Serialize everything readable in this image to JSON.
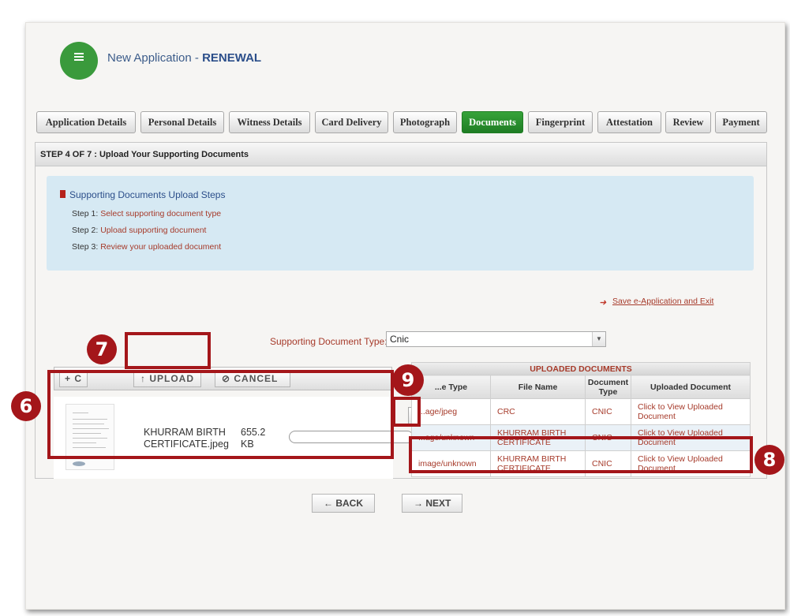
{
  "header": {
    "title_prefix": "New Application - ",
    "title_emphasis": "RENEWAL"
  },
  "tabs": [
    {
      "label": "Application Details",
      "active": false
    },
    {
      "label": "Personal Details",
      "active": false
    },
    {
      "label": "Witness Details",
      "active": false
    },
    {
      "label": "Card Delivery",
      "active": false
    },
    {
      "label": "Photograph",
      "active": false
    },
    {
      "label": "Documents",
      "active": true
    },
    {
      "label": "Fingerprint",
      "active": false
    },
    {
      "label": "Attestation",
      "active": false
    },
    {
      "label": "Review",
      "active": false
    },
    {
      "label": "Payment",
      "active": false
    }
  ],
  "step_bar": "STEP 4 OF 7 : Upload Your Supporting Documents",
  "steps_box": {
    "heading": "Supporting Documents Upload Steps",
    "steps": [
      {
        "prefix": "Step 1:",
        "text": "Select supporting document type"
      },
      {
        "prefix": "Step 2:",
        "text": "Upload supporting document"
      },
      {
        "prefix": "Step 3:",
        "text": "Review your uploaded document"
      }
    ]
  },
  "save_exit": "Save e-Application and Exit",
  "doc_type": {
    "label": "Supporting Document Type:",
    "required_mark": "*",
    "selected": "Cnic"
  },
  "upload_toolbar": {
    "choose_label": "+ C",
    "upload_label": "↑ UPLOAD",
    "cancel_label": "⊘ CANCEL"
  },
  "file": {
    "name": "KHURRAM BIRTH CERTIFICATE.jpeg",
    "size": "655.2 KB",
    "remove_label": "×"
  },
  "uploaded": {
    "caption": "UPLOADED DOCUMENTS",
    "columns": [
      "...e Type",
      "File Name",
      "Document Type",
      "Uploaded Document"
    ],
    "rows": [
      {
        "file_type": "...age/jpeg",
        "file_name": "CRC",
        "doc_type": "CNIC",
        "link": "Click to View Uploaded Document"
      },
      {
        "file_type": "...age/unknown",
        "file_name": "KHURRAM BIRTH CERTIFICATE",
        "doc_type": "CNIC",
        "link": "Click to View Uploaded Document"
      },
      {
        "file_type": "image/unknown",
        "file_name": "KHURRAM BIRTH CERTIFICATE",
        "doc_type": "CNIC",
        "link": "Click to View Uploaded Document"
      }
    ]
  },
  "nav": {
    "back_label": "← BACK",
    "next_label": "→ NEXT"
  },
  "callouts": [
    "6",
    "7",
    "8",
    "9"
  ],
  "colors": {
    "accent_green": "#2e9a33",
    "callout_red": "#a4161a",
    "link_brown": "#a63a2a",
    "info_blue": "#d6e9f3"
  }
}
